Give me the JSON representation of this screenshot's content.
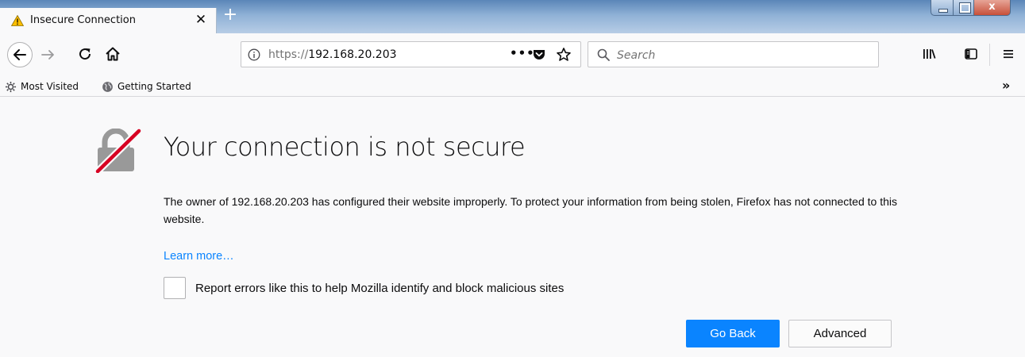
{
  "tab": {
    "title": "Insecure Connection",
    "close_glyph": "✕",
    "warning_icon": "warning-icon",
    "new_tab_glyph": "+"
  },
  "window_controls": {
    "close_glyph": "x"
  },
  "toolbar": {
    "url_scheme": "https://",
    "url_host": "192.168.20.203",
    "page_actions_glyph": "•••",
    "search_placeholder": "Search",
    "bookmark_overflow_glyph": "»"
  },
  "bookmarks": [
    {
      "label": "Most Visited",
      "icon": "gear-icon"
    },
    {
      "label": "Getting Started",
      "icon": "globe-icon"
    }
  ],
  "error": {
    "title": "Your connection is not secure",
    "description": "The owner of 192.168.20.203 has configured their website improperly. To protect your information from being stolen, Firefox has not connected to this website.",
    "learn_more": "Learn more…",
    "report_label": "Report errors like this to help Mozilla identify and block malicious sites",
    "go_back_label": "Go Back",
    "advanced_label": "Advanced"
  },
  "colors": {
    "accent_blue": "#0a84ff",
    "warning_yellow": "#ffbf00",
    "broken_lock_red": "#d70022",
    "lock_gray": "#999999"
  }
}
